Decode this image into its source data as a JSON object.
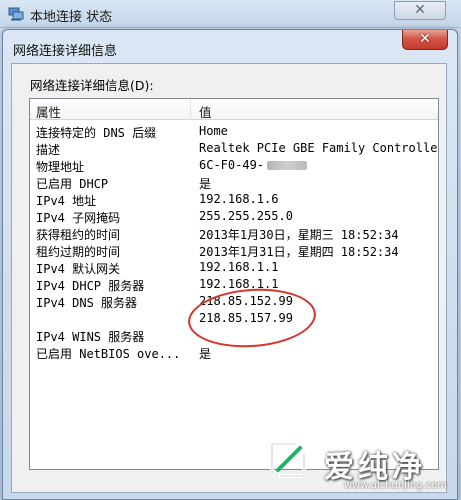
{
  "back_window": {
    "title": "本地连接 状态",
    "close_glyph": "✕"
  },
  "dialog": {
    "title": "网络连接详细信息",
    "close_glyph": "✕",
    "list_label": "网络连接详细信息(D):",
    "columns": [
      "属性",
      "值"
    ],
    "rows": [
      {
        "property": "连接特定的 DNS 后缀",
        "value": "Home"
      },
      {
        "property": "描述",
        "value": "Realtek PCIe GBE Family Controlle"
      },
      {
        "property": "物理地址",
        "value": "6C-F0-49-"
      },
      {
        "property": "已启用 DHCP",
        "value": "是"
      },
      {
        "property": "IPv4 地址",
        "value": "192.168.1.6"
      },
      {
        "property": "IPv4 子网掩码",
        "value": "255.255.255.0"
      },
      {
        "property": "获得租约的时间",
        "value": "2013年1月30日，星期三 18:52:34"
      },
      {
        "property": "租约过期的时间",
        "value": "2013年1月31日，星期四 18:52:34"
      },
      {
        "property": "IPv4 默认网关",
        "value": "192.168.1.1"
      },
      {
        "property": "IPv4 DHCP 服务器",
        "value": "192.168.1.1"
      },
      {
        "property": "IPv4 DNS 服务器",
        "value": "218.85.152.99"
      },
      {
        "property": "",
        "value": "218.85.157.99"
      },
      {
        "property": "IPv4 WINS 服务器",
        "value": ""
      },
      {
        "property": "已启用 NetBIOS ove...",
        "value": "是"
      }
    ]
  },
  "watermark": {
    "title": "爱纯净",
    "url": "www.aichunjing.com"
  },
  "colors": {
    "highlight_circle": "#d8332a",
    "close_button": "#c23b2c"
  }
}
